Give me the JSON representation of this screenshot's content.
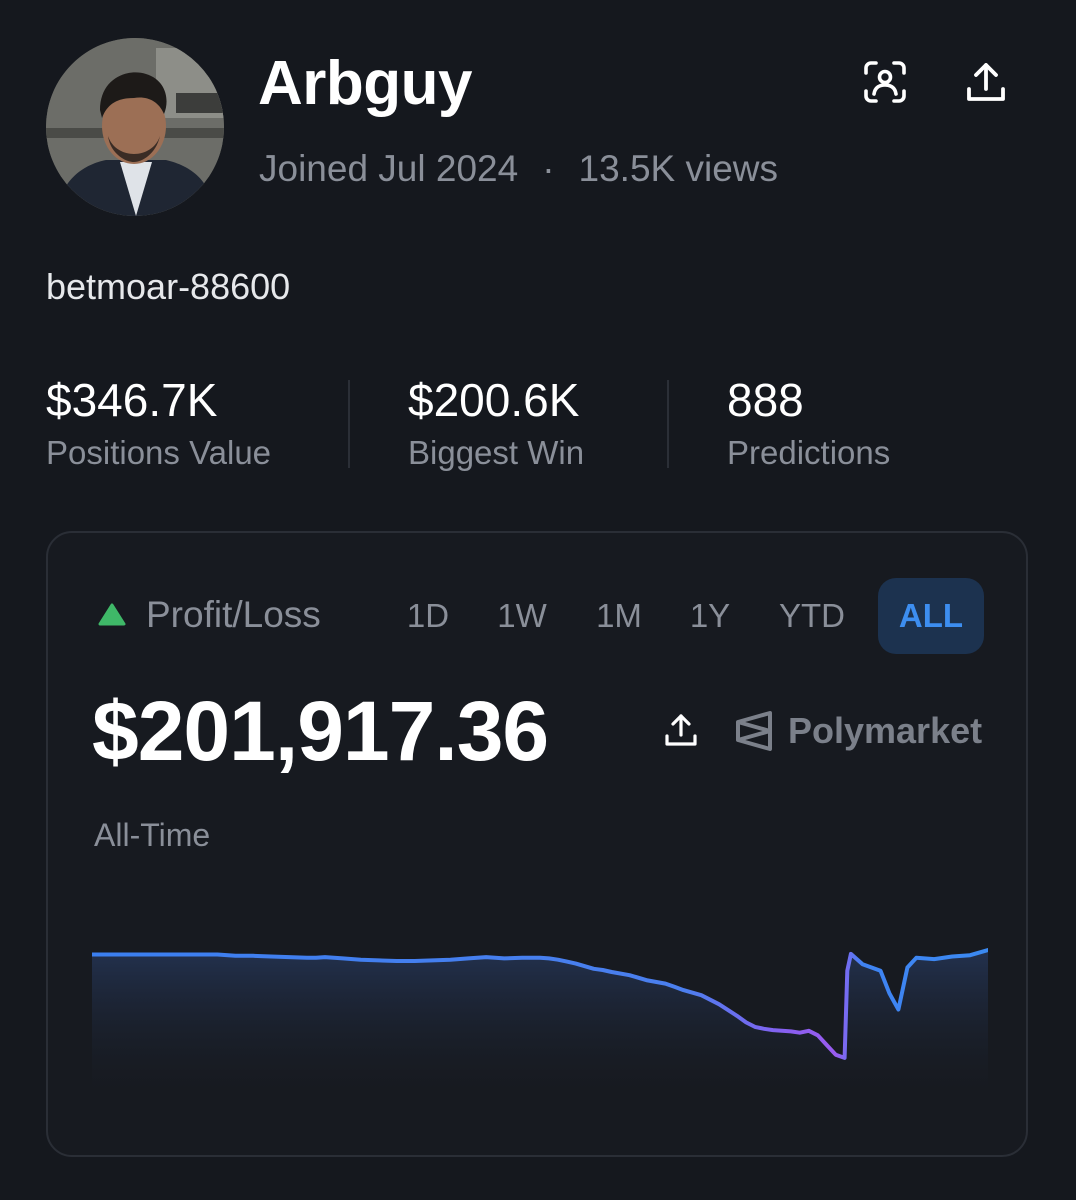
{
  "profile": {
    "username": "Arbguy",
    "joined": "Joined Jul 2024",
    "views": "13.5K views",
    "separator": "·",
    "handle": "betmoar-88600"
  },
  "header_icons": [
    "face-scan-icon",
    "share-icon"
  ],
  "stats": [
    {
      "value": "$346.7K",
      "label": "Positions Value"
    },
    {
      "value": "$200.6K",
      "label": "Biggest Win"
    },
    {
      "value": "888",
      "label": "Predictions"
    }
  ],
  "pnl": {
    "label": "Profit/Loss",
    "tabs": [
      "1D",
      "1W",
      "1M",
      "1Y",
      "YTD",
      "ALL"
    ],
    "active_tab": "ALL",
    "amount": "$201,917.36",
    "brand": "Polymarket",
    "period_label": "All-Time"
  },
  "colors": {
    "background": "#15181e",
    "positive": "#3fb868",
    "accent": "#3d8ef0",
    "line_start": "#3b7ff0",
    "line_dip": "#9a5cf0"
  },
  "chart_data": {
    "type": "line",
    "title": "",
    "xlabel": "",
    "ylabel": "",
    "x": [
      0,
      2,
      4,
      6,
      8,
      10,
      12,
      14,
      16,
      18,
      20,
      22,
      24,
      25,
      26,
      28,
      30,
      32,
      34,
      36,
      38,
      40,
      42,
      44,
      46,
      48,
      50,
      51,
      52,
      53,
      54,
      55,
      56,
      57,
      58,
      60,
      62,
      64,
      65,
      66,
      68,
      70,
      72,
      73,
      74,
      75,
      76,
      77,
      78,
      79,
      80,
      81,
      82,
      83,
      84,
      84.3,
      84.7,
      86,
      88,
      89,
      90,
      91,
      92,
      94,
      96,
      98,
      100
    ],
    "values": [
      65,
      65,
      65,
      65,
      65,
      65,
      65,
      65,
      63,
      63,
      62,
      61,
      60,
      60,
      61,
      59,
      57,
      56,
      55,
      55,
      56,
      57,
      59,
      61,
      59,
      60,
      60,
      59,
      57,
      54,
      51,
      47,
      43,
      41,
      38,
      33,
      25,
      20,
      15,
      10,
      2,
      -12,
      -30,
      -40,
      -47,
      -50,
      -52,
      -53,
      -54,
      -56,
      -53,
      -60,
      -75,
      -90,
      -95,
      40,
      66,
      50,
      40,
      5,
      -20,
      45,
      60,
      58,
      62,
      64,
      72
    ],
    "ylim": [
      -140,
      120
    ],
    "grid": false,
    "legend": "none"
  }
}
